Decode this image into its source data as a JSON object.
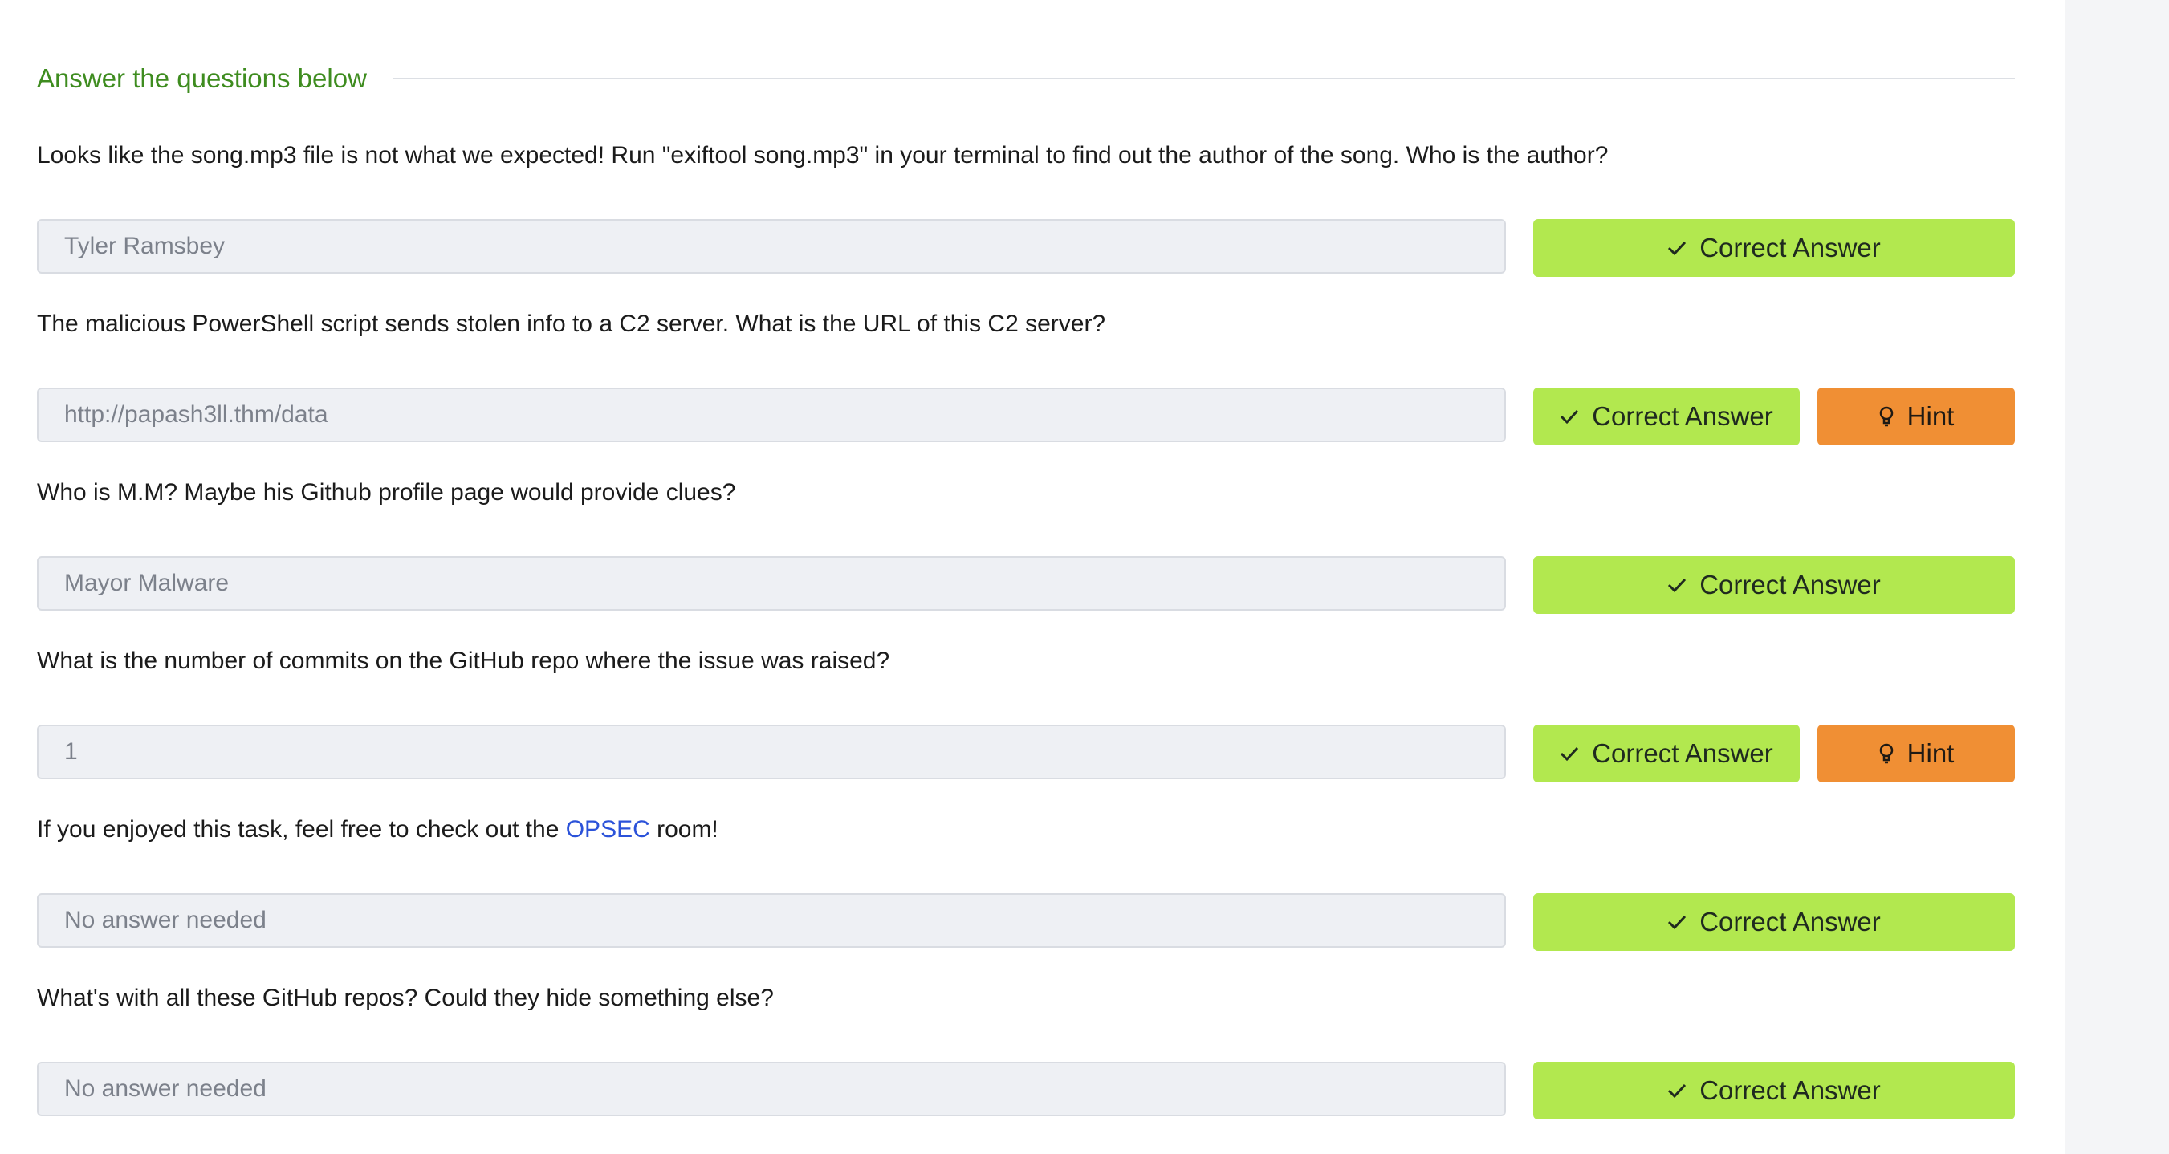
{
  "section": {
    "title": "Answer the questions below"
  },
  "questions": [
    {
      "text": "Looks like the song.mp3 file is not what we expected! Run \"exiftool song.mp3\" in your terminal to find out the author of the song. Who is the author?",
      "answer": "Tyler Ramsbey",
      "correct_label": "Correct Answer"
    },
    {
      "text": "The malicious PowerShell script sends stolen info to a C2 server. What is the URL of this C2 server?",
      "answer": "http://papash3ll.thm/data",
      "correct_label": "Correct Answer",
      "hint_label": "Hint"
    },
    {
      "text": "Who is M.M? Maybe his Github profile page would provide clues?",
      "answer": "Mayor Malware",
      "correct_label": "Correct Answer"
    },
    {
      "text": "What is the number of commits on the GitHub repo where the issue was raised?",
      "answer": "1",
      "correct_label": "Correct Answer",
      "hint_label": "Hint"
    },
    {
      "text_before": "If you enjoyed this task, feel free to check out the ",
      "link_text": "OPSEC",
      "text_after": " room!",
      "answer": "No answer needed",
      "correct_label": "Correct Answer"
    },
    {
      "text": "What's with all these GitHub repos? Could they hide something else?",
      "answer": "No answer needed",
      "correct_label": "Correct Answer"
    }
  ],
  "icons": {
    "correct": "check-icon",
    "hint": "lightbulb-icon"
  },
  "colors": {
    "section_title": "#3e8c1f",
    "correct_button": "#b2e84f",
    "hint_button": "#f08f34",
    "link": "#2b52d9",
    "input_background": "#eef0f4"
  }
}
